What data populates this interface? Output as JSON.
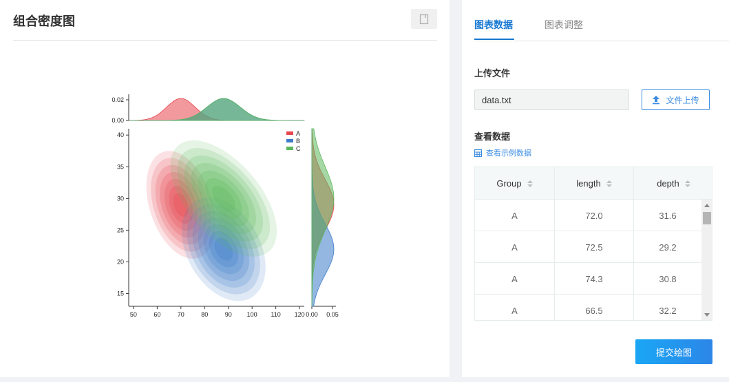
{
  "page_title": "组合密度图",
  "tabs": [
    {
      "label": "图表数据"
    },
    {
      "label": "图表调整"
    }
  ],
  "upload": {
    "section_label": "上传文件",
    "file_name": "data.txt",
    "button_label": "文件上传"
  },
  "view": {
    "section_label": "查看数据",
    "example_link": "查看示例数据"
  },
  "table": {
    "columns": [
      "Group",
      "length",
      "depth"
    ],
    "rows": [
      [
        "A",
        "72.0",
        "31.6"
      ],
      [
        "A",
        "72.5",
        "29.2"
      ],
      [
        "A",
        "74.3",
        "30.8"
      ],
      [
        "A",
        "66.5",
        "32.2"
      ]
    ]
  },
  "submit_label": "提交绘图",
  "colors": {
    "accent": "#1677d2",
    "A": "#e8464f",
    "B": "#3d7cc9",
    "C": "#5cb85c"
  },
  "chart_data": {
    "type": "density-2d-with-marginals",
    "legend": [
      "A",
      "B",
      "C"
    ],
    "legend_position": "top-right",
    "x_ticks": [
      "50",
      "60",
      "70",
      "80",
      "90",
      "100",
      "110",
      "120"
    ],
    "y_ticks": [
      "15",
      "20",
      "25",
      "30",
      "35",
      "40"
    ],
    "top_margin_ticks": [
      "0.00",
      "0.02"
    ],
    "right_margin_ticks": [
      "0.00",
      "0.05"
    ],
    "xlim": [
      48,
      122
    ],
    "ylim": [
      13,
      41
    ],
    "series": [
      {
        "name": "A",
        "color": "#e8464f",
        "center": [
          70,
          29
        ],
        "spread": [
          6,
          4
        ],
        "corr": 0.3
      },
      {
        "name": "B",
        "color": "#3d7cc9",
        "center": [
          88,
          22
        ],
        "spread": [
          7,
          4
        ],
        "corr": 0.5
      },
      {
        "name": "C",
        "color": "#5cb85c",
        "center": [
          88,
          30
        ],
        "spread": [
          7,
          5
        ],
        "corr": 0.75
      }
    ]
  }
}
